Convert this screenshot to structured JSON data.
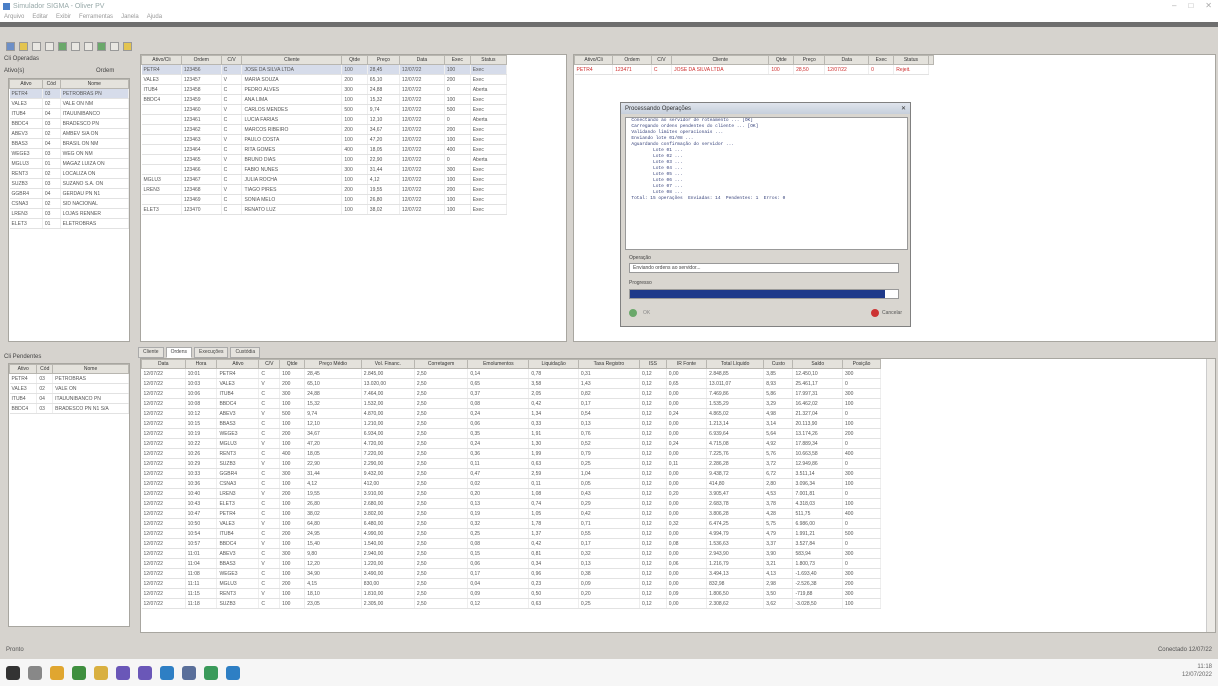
{
  "window": {
    "title": "Simulador SIGMA - Oliver PV",
    "controls": [
      "–",
      "□",
      "✕"
    ]
  },
  "menu": [
    "Arquivo",
    "Editar",
    "Exibir",
    "Ferramentas",
    "Janela",
    "Ajuda"
  ],
  "toolbar": {
    "icons": [
      "new-icon",
      "open-icon",
      "save-icon",
      "print-icon",
      "refresh-icon",
      "search-icon",
      "filter-icon",
      "export-icon",
      "settings-icon",
      "help-icon"
    ]
  },
  "left_top": {
    "title": "Cli Operadas",
    "subhead": [
      "Ativo(s)",
      "Ordem"
    ],
    "columns": [
      "Ativo",
      "Cód",
      "Nome"
    ],
    "rows": [
      [
        "PETR4",
        "03",
        "PETROBRAS PN"
      ],
      [
        "VALE3",
        "02",
        "VALE ON NM"
      ],
      [
        "ITUB4",
        "04",
        "ITAUUNIBANCO"
      ],
      [
        "BBDC4",
        "03",
        "BRADESCO PN"
      ],
      [
        "ABEV3",
        "02",
        "AMBEV S/A ON"
      ],
      [
        "BBAS3",
        "04",
        "BRASIL ON NM"
      ],
      [
        "WEGE3",
        "03",
        "WEG ON NM"
      ],
      [
        "MGLU3",
        "01",
        "MAGAZ LUIZA ON"
      ],
      [
        "RENT3",
        "02",
        "LOCALIZA ON"
      ],
      [
        "SUZB3",
        "03",
        "SUZANO S.A. ON"
      ],
      [
        "GGBR4",
        "04",
        "GERDAU PN N1"
      ],
      [
        "CSNA3",
        "02",
        "SID NACIONAL"
      ],
      [
        "LREN3",
        "03",
        "LOJAS RENNER"
      ],
      [
        "ELET3",
        "01",
        "ELETROBRAS"
      ]
    ]
  },
  "left_bottom": {
    "title": "Cli Pendentes",
    "columns": [
      "Ativo",
      "Cód",
      "Nome"
    ],
    "rows": [
      [
        "PETR4",
        "03",
        "PETROBRAS"
      ],
      [
        "VALE3",
        "02",
        "VALE ON"
      ],
      [
        "ITUB4",
        "04",
        "ITAUUNIBANCO PN"
      ],
      [
        "BBDC4",
        "03",
        "BRADESCO PN N1 S/A"
      ]
    ]
  },
  "orders": {
    "columns": [
      "Ativo/Cli",
      "Ordem",
      "C/V",
      "Cliente",
      "Qtde",
      "Preço",
      "Data",
      "Exec",
      "Status"
    ],
    "rows": [
      [
        "PETR4",
        "123456",
        "C",
        "JOSE DA SILVA LTDA",
        "100",
        "28,45",
        "12/07/22",
        "100",
        "Exec"
      ],
      [
        "VALE3",
        "123457",
        "V",
        "MARIA SOUZA",
        "200",
        "65,10",
        "12/07/22",
        "200",
        "Exec"
      ],
      [
        "ITUB4",
        "123458",
        "C",
        "PEDRO ALVES",
        "300",
        "24,88",
        "12/07/22",
        "0",
        "Aberta"
      ],
      [
        "BBDC4",
        "123459",
        "C",
        "ANA LIMA",
        "100",
        "15,32",
        "12/07/22",
        "100",
        "Exec"
      ],
      [
        "",
        "123460",
        "V",
        "CARLOS MENDES",
        "500",
        "9,74",
        "12/07/22",
        "500",
        "Exec"
      ],
      [
        "",
        "123461",
        "C",
        "LUCIA FARIAS",
        "100",
        "12,10",
        "12/07/22",
        "0",
        "Aberta"
      ],
      [
        "",
        "123462",
        "C",
        "MARCOS RIBEIRO",
        "200",
        "34,67",
        "12/07/22",
        "200",
        "Exec"
      ],
      [
        "",
        "123463",
        "V",
        "PAULO COSTA",
        "100",
        "47,20",
        "12/07/22",
        "100",
        "Exec"
      ],
      [
        "",
        "123464",
        "C",
        "RITA GOMES",
        "400",
        "18,05",
        "12/07/22",
        "400",
        "Exec"
      ],
      [
        "",
        "123465",
        "V",
        "BRUNO DIAS",
        "100",
        "22,90",
        "12/07/22",
        "0",
        "Aberta"
      ],
      [
        "",
        "123466",
        "C",
        "FABIO NUNES",
        "300",
        "31,44",
        "12/07/22",
        "300",
        "Exec"
      ],
      [
        "MGLU3",
        "123467",
        "C",
        "JULIA ROCHA",
        "100",
        "4,12",
        "12/07/22",
        "100",
        "Exec"
      ],
      [
        "LREN3",
        "123468",
        "V",
        "TIAGO PIRES",
        "200",
        "19,55",
        "12/07/22",
        "200",
        "Exec"
      ],
      [
        "",
        "123469",
        "C",
        "SONIA MELO",
        "100",
        "26,80",
        "12/07/22",
        "100",
        "Exec"
      ],
      [
        "ELET3",
        "123470",
        "C",
        "RENATO LUZ",
        "100",
        "38,02",
        "12/07/22",
        "100",
        "Exec"
      ]
    ]
  },
  "right_orders": {
    "columns": [
      "Ativo/Cli",
      "Ordem",
      "C/V",
      "Cliente",
      "Qtde",
      "Preço",
      "Data",
      "Exec",
      "Status",
      ""
    ],
    "rows": [
      [
        "PETR4",
        "123471",
        "C",
        "JOSE DA SILVA LTDA",
        "100",
        "28,50",
        "12/07/22",
        "0",
        "Rejeit."
      ]
    ]
  },
  "dialog": {
    "title": "Processando Operações",
    "close": "✕",
    "log": [
      "  Conectando ao servidor de roteamento ... [OK]",
      "  Carregando ordens pendentes do cliente ... [OK]",
      "  Validando limites operacionais ...",
      "  Enviando lote 01/08 ...",
      "  Aguardando confirmação do servidor ...",
      "",
      "          Lote 01 ...",
      "          Lote 02 ...",
      "          Lote 03 ...",
      "          Lote 04 ...",
      "          Lote 05 ...",
      "          Lote 06 ...",
      "          Lote 07 ...",
      "          Lote 08 ...",
      "",
      "  Total: 15 operações  Enviadas: 14  Pendentes: 1  Erros: 0"
    ],
    "label_status": "Operação",
    "status_value": "Enviando ordens ao servidor...",
    "label_progress": "Progresso",
    "progress": 0.95,
    "ok_label": "OK",
    "cancel_label": "Cancelar"
  },
  "tabs": [
    "Cliente",
    "Ordens",
    "Execuções",
    "Custódia"
  ],
  "grid": {
    "columns": [
      "Data",
      "Hora",
      "Ativo",
      "C/V",
      "Qtde",
      "Preço Médio",
      "Vol. Financ.",
      "Corretagem",
      "Emolumentos",
      "Liquidação",
      "Taxa Registro",
      "ISS",
      "IR Fonte",
      "Total Líquido",
      "Custo",
      "Saldo",
      "Posição"
    ],
    "rows": [
      [
        "12/07/22",
        "10:01",
        "PETR4",
        "C",
        "100",
        "28,45",
        "2.845,00",
        "2,50",
        "0,14",
        "0,78",
        "0,31",
        "0,12",
        "0,00",
        "2.848,85",
        "3,85",
        "12.450,10",
        "300"
      ],
      [
        "12/07/22",
        "10:03",
        "VALE3",
        "V",
        "200",
        "65,10",
        "13.020,00",
        "2,50",
        "0,65",
        "3,58",
        "1,43",
        "0,12",
        "0,65",
        "13.011,07",
        "8,93",
        "25.461,17",
        "0"
      ],
      [
        "12/07/22",
        "10:06",
        "ITUB4",
        "C",
        "300",
        "24,88",
        "7.464,00",
        "2,50",
        "0,37",
        "2,05",
        "0,82",
        "0,12",
        "0,00",
        "7.469,86",
        "5,86",
        "17.997,31",
        "300"
      ],
      [
        "12/07/22",
        "10:08",
        "BBDC4",
        "C",
        "100",
        "15,32",
        "1.532,00",
        "2,50",
        "0,08",
        "0,42",
        "0,17",
        "0,12",
        "0,00",
        "1.535,29",
        "3,29",
        "16.462,02",
        "100"
      ],
      [
        "12/07/22",
        "10:12",
        "ABEV3",
        "V",
        "500",
        "9,74",
        "4.870,00",
        "2,50",
        "0,24",
        "1,34",
        "0,54",
        "0,12",
        "0,24",
        "4.865,02",
        "4,98",
        "21.327,04",
        "0"
      ],
      [
        "12/07/22",
        "10:15",
        "BBAS3",
        "C",
        "100",
        "12,10",
        "1.210,00",
        "2,50",
        "0,06",
        "0,33",
        "0,13",
        "0,12",
        "0,00",
        "1.213,14",
        "3,14",
        "20.113,90",
        "100"
      ],
      [
        "12/07/22",
        "10:19",
        "WEGE3",
        "C",
        "200",
        "34,67",
        "6.934,00",
        "2,50",
        "0,35",
        "1,91",
        "0,76",
        "0,12",
        "0,00",
        "6.939,64",
        "5,64",
        "13.174,26",
        "200"
      ],
      [
        "12/07/22",
        "10:22",
        "MGLU3",
        "V",
        "100",
        "47,20",
        "4.720,00",
        "2,50",
        "0,24",
        "1,30",
        "0,52",
        "0,12",
        "0,24",
        "4.715,08",
        "4,92",
        "17.889,34",
        "0"
      ],
      [
        "12/07/22",
        "10:26",
        "RENT3",
        "C",
        "400",
        "18,05",
        "7.220,00",
        "2,50",
        "0,36",
        "1,99",
        "0,79",
        "0,12",
        "0,00",
        "7.225,76",
        "5,76",
        "10.663,58",
        "400"
      ],
      [
        "12/07/22",
        "10:29",
        "SUZB3",
        "V",
        "100",
        "22,90",
        "2.290,00",
        "2,50",
        "0,11",
        "0,63",
        "0,25",
        "0,12",
        "0,11",
        "2.286,28",
        "3,72",
        "12.949,86",
        "0"
      ],
      [
        "12/07/22",
        "10:33",
        "GGBR4",
        "C",
        "300",
        "31,44",
        "9.432,00",
        "2,50",
        "0,47",
        "2,59",
        "1,04",
        "0,12",
        "0,00",
        "9.438,72",
        "6,72",
        "3.511,14",
        "300"
      ],
      [
        "12/07/22",
        "10:36",
        "CSNA3",
        "C",
        "100",
        "4,12",
        "412,00",
        "2,50",
        "0,02",
        "0,11",
        "0,05",
        "0,12",
        "0,00",
        "414,80",
        "2,80",
        "3.096,34",
        "100"
      ],
      [
        "12/07/22",
        "10:40",
        "LREN3",
        "V",
        "200",
        "19,55",
        "3.910,00",
        "2,50",
        "0,20",
        "1,08",
        "0,43",
        "0,12",
        "0,20",
        "3.905,47",
        "4,53",
        "7.001,81",
        "0"
      ],
      [
        "12/07/22",
        "10:43",
        "ELET3",
        "C",
        "100",
        "26,80",
        "2.680,00",
        "2,50",
        "0,13",
        "0,74",
        "0,29",
        "0,12",
        "0,00",
        "2.683,78",
        "3,78",
        "4.318,03",
        "100"
      ],
      [
        "12/07/22",
        "10:47",
        "PETR4",
        "C",
        "100",
        "38,02",
        "3.802,00",
        "2,50",
        "0,19",
        "1,05",
        "0,42",
        "0,12",
        "0,00",
        "3.806,28",
        "4,28",
        "511,75",
        "400"
      ],
      [
        "12/07/22",
        "10:50",
        "VALE3",
        "V",
        "100",
        "64,80",
        "6.480,00",
        "2,50",
        "0,32",
        "1,78",
        "0,71",
        "0,12",
        "0,32",
        "6.474,25",
        "5,75",
        "6.986,00",
        "0"
      ],
      [
        "12/07/22",
        "10:54",
        "ITUB4",
        "C",
        "200",
        "24,95",
        "4.990,00",
        "2,50",
        "0,25",
        "1,37",
        "0,55",
        "0,12",
        "0,00",
        "4.994,79",
        "4,79",
        "1.991,21",
        "500"
      ],
      [
        "12/07/22",
        "10:57",
        "BBDC4",
        "V",
        "100",
        "15,40",
        "1.540,00",
        "2,50",
        "0,08",
        "0,42",
        "0,17",
        "0,12",
        "0,08",
        "1.536,63",
        "3,37",
        "3.527,84",
        "0"
      ],
      [
        "12/07/22",
        "11:01",
        "ABEV3",
        "C",
        "300",
        "9,80",
        "2.940,00",
        "2,50",
        "0,15",
        "0,81",
        "0,32",
        "0,12",
        "0,00",
        "2.943,90",
        "3,90",
        "583,94",
        "300"
      ],
      [
        "12/07/22",
        "11:04",
        "BBAS3",
        "V",
        "100",
        "12,20",
        "1.220,00",
        "2,50",
        "0,06",
        "0,34",
        "0,13",
        "0,12",
        "0,06",
        "1.216,79",
        "3,21",
        "1.800,73",
        "0"
      ],
      [
        "12/07/22",
        "11:08",
        "WEGE3",
        "C",
        "100",
        "34,90",
        "3.490,00",
        "2,50",
        "0,17",
        "0,96",
        "0,38",
        "0,12",
        "0,00",
        "3.494,13",
        "4,13",
        "-1.693,40",
        "300"
      ],
      [
        "12/07/22",
        "11:11",
        "MGLU3",
        "C",
        "200",
        "4,15",
        "830,00",
        "2,50",
        "0,04",
        "0,23",
        "0,09",
        "0,12",
        "0,00",
        "832,98",
        "2,98",
        "-2.526,38",
        "200"
      ],
      [
        "12/07/22",
        "11:15",
        "RENT3",
        "V",
        "100",
        "18,10",
        "1.810,00",
        "2,50",
        "0,09",
        "0,50",
        "0,20",
        "0,12",
        "0,09",
        "1.806,50",
        "3,50",
        "-719,88",
        "300"
      ],
      [
        "12/07/22",
        "11:18",
        "SUZB3",
        "C",
        "100",
        "23,05",
        "2.305,00",
        "2,50",
        "0,12",
        "0,63",
        "0,25",
        "0,12",
        "0,00",
        "2.308,62",
        "3,62",
        "-3.028,50",
        "100"
      ]
    ]
  },
  "status": {
    "left": "Pronto",
    "right": "Conectado  12/07/22"
  },
  "taskbar": {
    "apps": [
      "start",
      "search",
      "files",
      "chrome",
      "mail",
      "teams",
      "excel",
      "edge",
      "calc",
      "store",
      "simulator"
    ],
    "time": "11:18",
    "date": "12/07/2022"
  }
}
